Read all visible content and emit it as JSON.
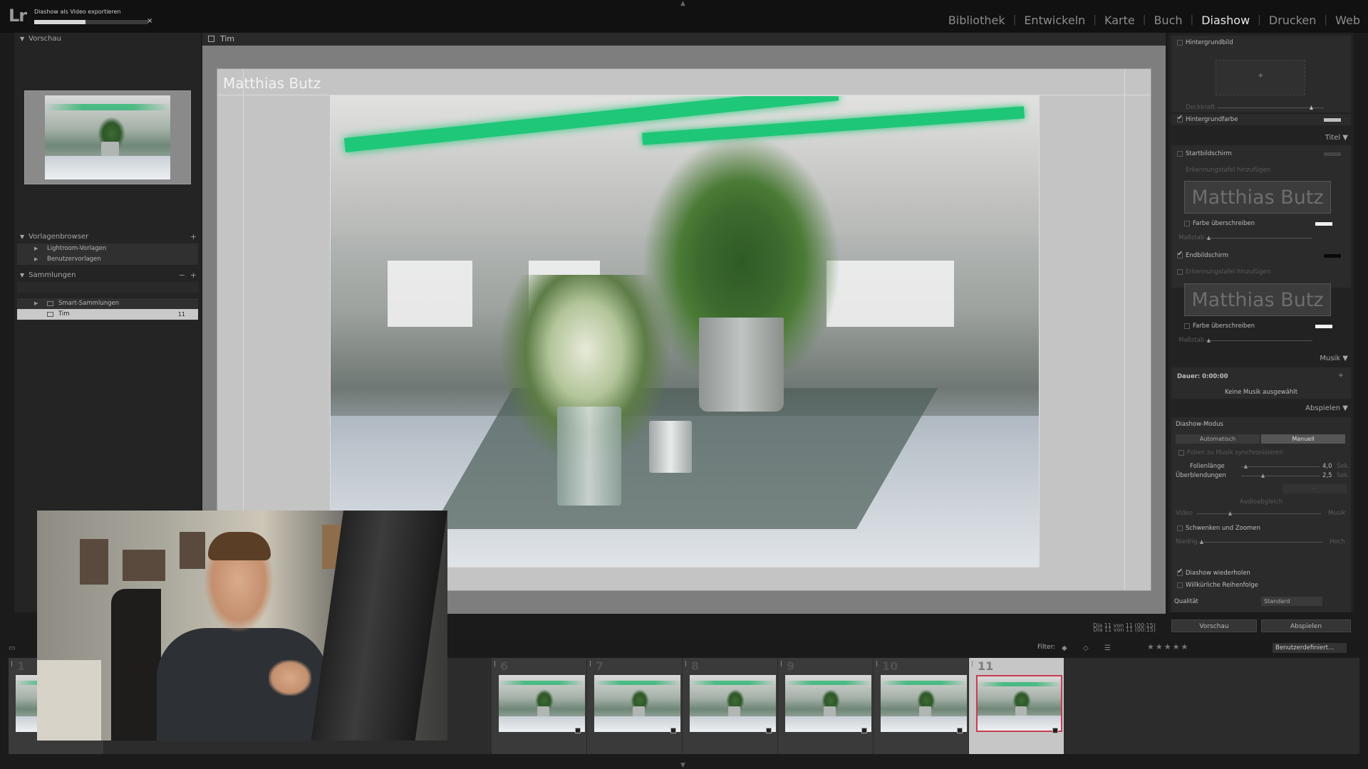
{
  "app": {
    "logo": "Lr",
    "export_status": "Diashow als Video exportieren",
    "export_progress": 0.45,
    "cancel_glyph": "×"
  },
  "modules": [
    {
      "label": "Bibliothek",
      "active": false
    },
    {
      "label": "Entwickeln",
      "active": false
    },
    {
      "label": "Karte",
      "active": false
    },
    {
      "label": "Buch",
      "active": false
    },
    {
      "label": "Diashow",
      "active": true
    },
    {
      "label": "Drucken",
      "active": false
    },
    {
      "label": "Web",
      "active": false
    }
  ],
  "left_panel": {
    "preview_header": "Vorschau",
    "template_header": "Vorlagenbrowser",
    "templates": [
      "Lightroom-Vorlagen",
      "Benutzervorlagen"
    ],
    "collections_header": "Sammlungen",
    "collections": [
      {
        "label": "Smart-Sammlungen",
        "count": ""
      },
      {
        "label": "Tim",
        "count": "11"
      }
    ]
  },
  "center": {
    "collection_name": "Tim",
    "slide_title": "Matthias Butz",
    "slide_counter": "Dia 11 von 11 (00:15)"
  },
  "right_panel": {
    "background_image_label": "Hintergrundbild",
    "opacity_label": "Deckkraft",
    "background_color_label": "Hintergrundfarbe",
    "title_section": "Titel",
    "intro_screen_label": "Startbildschirm",
    "add_identity_label": "Erkennungstafel hinzufügen",
    "identity_text": "Matthias Butz",
    "override_color_label": "Farbe überschreiben",
    "scale_label": "Maßstab",
    "ending_screen_label": "Endbildschirm",
    "music_section": "Musik",
    "duration_label": "Dauer: 0:00:00",
    "no_music_label": "Keine Musik ausgewählt",
    "playback_section": "Abspielen",
    "mode_label": "Diashow-Modus",
    "mode_auto": "Automatisch",
    "mode_manual": "Manuell",
    "fit_label": "Folien zu Musik synchronisieren",
    "slide_length_label": "Folienlänge",
    "slide_length_value": "4,0",
    "slide_length_unit": "Sek.",
    "transition_label": "Überblendungen",
    "transition_value": "2,5",
    "transition_unit": "Sek.",
    "audio_balance_label": "Audioabgleich",
    "video_label": "Video",
    "music_label": "Musik",
    "pan_zoom_label": "Schwenken und Zoomen",
    "low_label": "Niedrig",
    "high_label": "Hoch",
    "repeat_label": "Diashow wiederholen",
    "random_order_label": "Willkürliche Reihenfolge",
    "quality_label": "Qualität",
    "quality_value": "Standard",
    "preview_button": "Vorschau",
    "play_button": "Abspielen"
  },
  "filmstrip": {
    "filter_label": "Filter:",
    "stars": "★★★★★",
    "preset": "Benutzerdefiniert...",
    "cells": [
      {
        "num": "1",
        "selected": false
      },
      {
        "num": "6",
        "selected": false
      },
      {
        "num": "7",
        "selected": false
      },
      {
        "num": "8",
        "selected": false
      },
      {
        "num": "9",
        "selected": false
      },
      {
        "num": "10",
        "selected": false
      },
      {
        "num": "11",
        "selected": true
      }
    ]
  },
  "colors": {
    "accent_selected": "#c83c52",
    "neon_green": "#1fc779"
  }
}
